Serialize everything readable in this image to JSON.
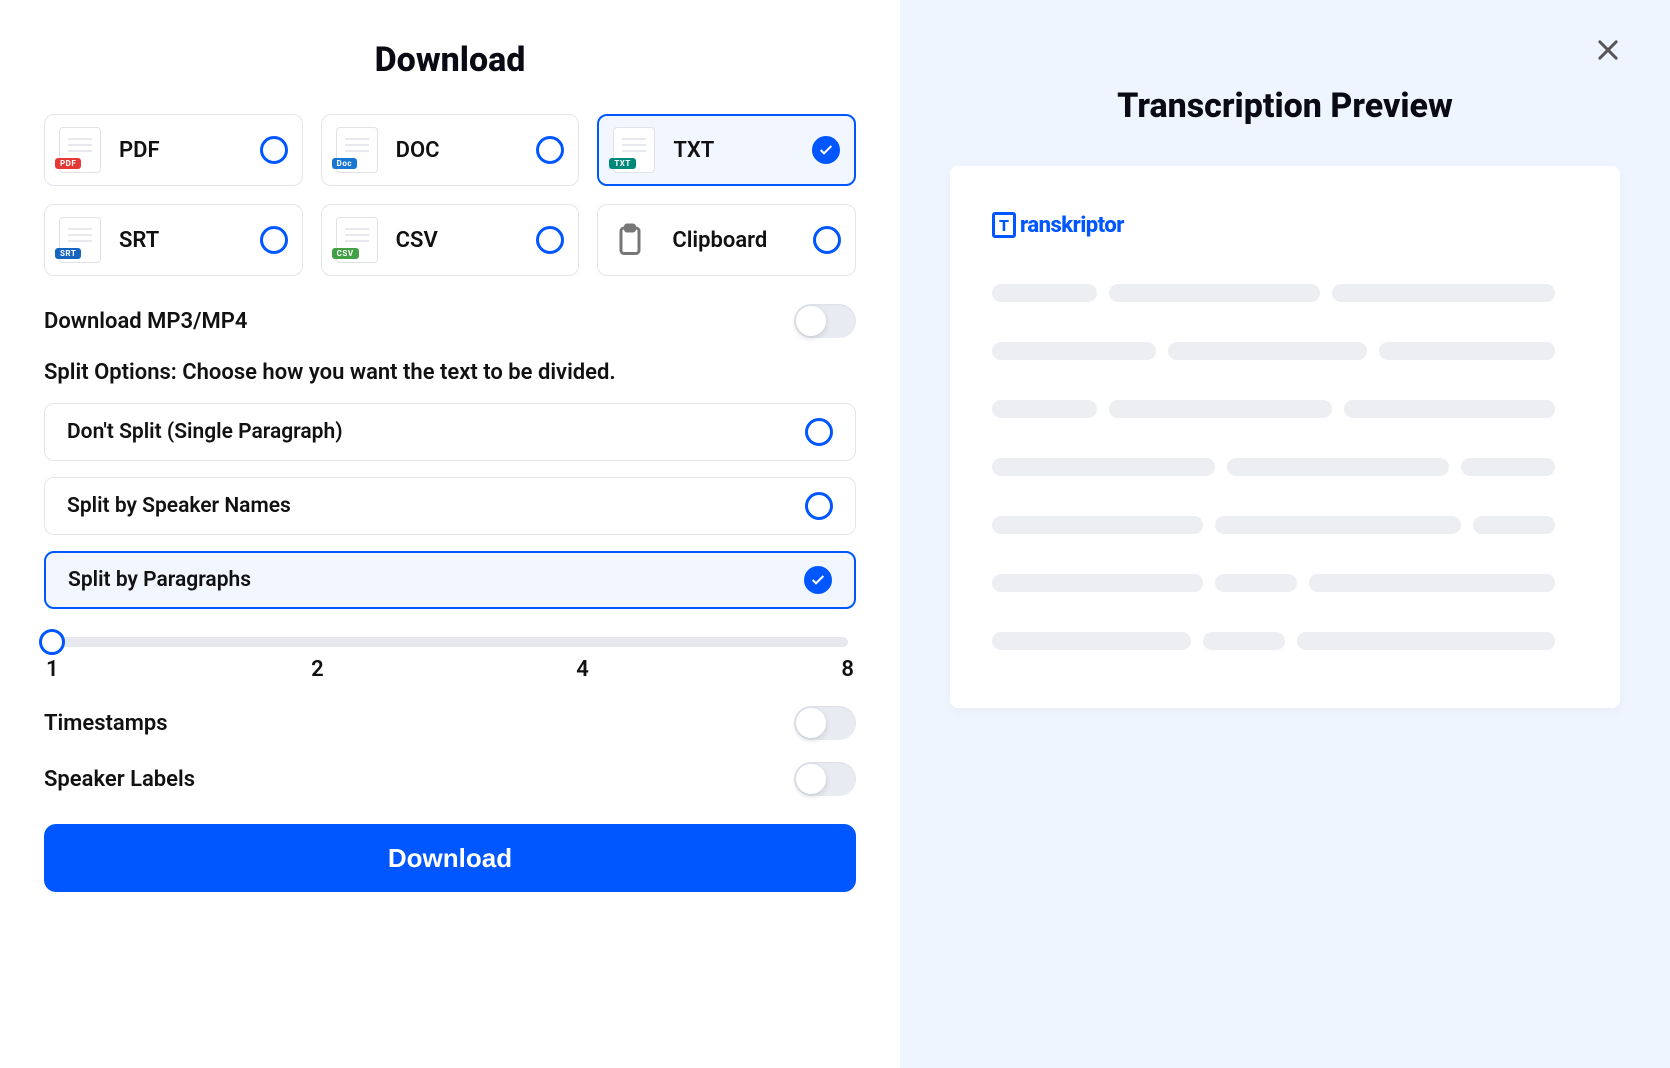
{
  "title": "Download",
  "formats": [
    {
      "id": "pdf",
      "label": "PDF",
      "tag": "PDF",
      "tagClass": "tag-pdf",
      "selected": false
    },
    {
      "id": "doc",
      "label": "DOC",
      "tag": "Doc",
      "tagClass": "tag-doc",
      "selected": false
    },
    {
      "id": "txt",
      "label": "TXT",
      "tag": "TXT",
      "tagClass": "tag-txt",
      "selected": true
    },
    {
      "id": "srt",
      "label": "SRT",
      "tag": "SRT",
      "tagClass": "tag-srt",
      "selected": false
    },
    {
      "id": "csv",
      "label": "CSV",
      "tag": "CSV",
      "tagClass": "tag-csv",
      "selected": false
    },
    {
      "id": "clipboard",
      "label": "Clipboard",
      "tag": null,
      "tagClass": null,
      "selected": false
    }
  ],
  "download_media_label": "Download MP3/MP4",
  "download_media_on": false,
  "split_section_label": "Split Options: Choose how you want the text to be divided.",
  "split_options": [
    {
      "id": "none",
      "label": "Don't Split (Single Paragraph)",
      "selected": false
    },
    {
      "id": "speaker",
      "label": "Split by Speaker Names",
      "selected": false
    },
    {
      "id": "paragraph",
      "label": "Split by Paragraphs",
      "selected": true
    }
  ],
  "slider": {
    "min": 1,
    "max": 8,
    "value": 1,
    "ticks": [
      "1",
      "2",
      "4",
      "8"
    ]
  },
  "timestamps_label": "Timestamps",
  "timestamps_on": false,
  "speaker_labels_label": "Speaker Labels",
  "speaker_labels_on": false,
  "download_button": "Download",
  "preview_title": "Transcription Preview",
  "brand_name": "ranskriptor",
  "brand_letter": "T"
}
